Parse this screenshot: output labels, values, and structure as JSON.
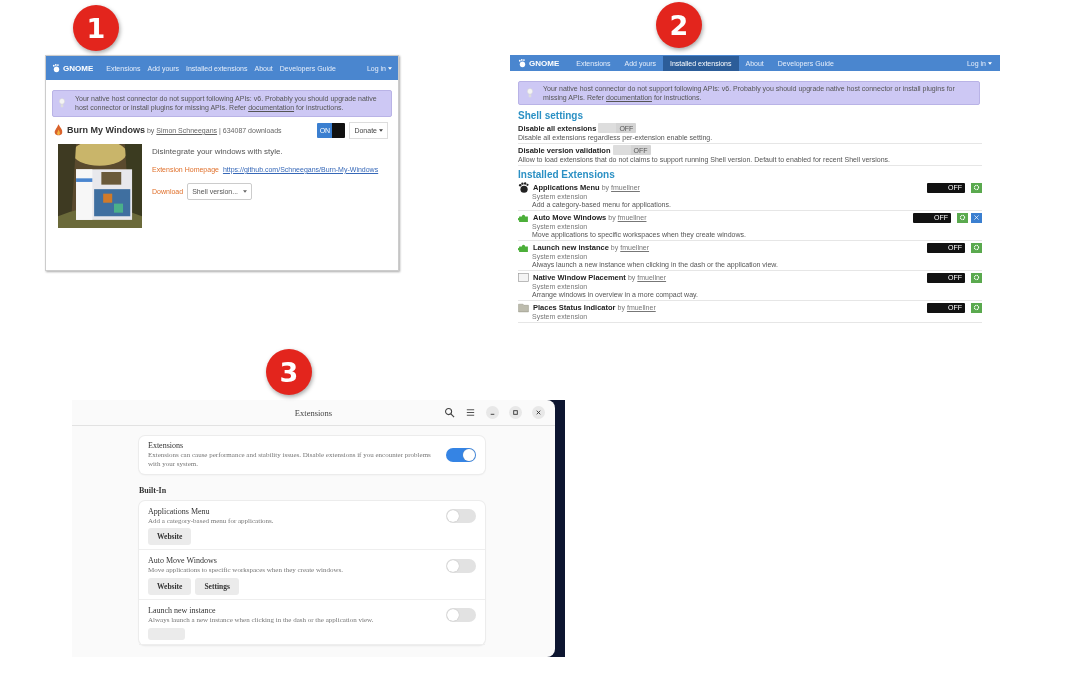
{
  "panels": [
    {
      "kind": "website",
      "badge": "1",
      "nav": {
        "logo": "GNOME",
        "items": [
          {
            "label": "Extensions",
            "selected": false
          },
          {
            "label": "Add yours",
            "selected": false
          },
          {
            "label": "Installed extensions",
            "selected": false
          },
          {
            "label": "About",
            "selected": false
          },
          {
            "label": "Developers Guide",
            "selected": false
          }
        ],
        "login": "Log in"
      },
      "notice": {
        "text": "Your native host connector do not support following APIs: v6. Probably you should upgrade native host connector or install plugins for missing APIs. Refer",
        "link": "documentation",
        "after": "for instructions."
      },
      "extension": {
        "name": "Burn My Windows",
        "by": "by",
        "author": "Simon Schneegans",
        "downloads": "| 634087 downloads",
        "on": true,
        "on_label": "ON",
        "donate": "Donate",
        "description": "Disintegrate your windows with style.",
        "homepage_label": "Extension Homepage",
        "homepage_url": "https://github.com/Schneegans/Burn-My-Windows",
        "download_label": "Download",
        "download_select": "Shell version..."
      }
    },
    {
      "kind": "installed",
      "badge": "2",
      "nav": {
        "logo": "GNOME",
        "items": [
          {
            "label": "Extensions",
            "selected": false
          },
          {
            "label": "Add yours",
            "selected": false
          },
          {
            "label": "Installed extensions",
            "selected": true
          },
          {
            "label": "About",
            "selected": false
          },
          {
            "label": "Developers Guide",
            "selected": false
          }
        ],
        "login": "Log in"
      },
      "notice": {
        "text": "Your native host connector do not support following APIs: v6. Probably you should upgrade native host connector or install plugins for missing APIs. Refer",
        "link": "documentation",
        "after": "for instructions."
      },
      "shell_heading": "Shell settings",
      "settings": [
        {
          "name": "Disable all extensions",
          "description": "Disable all extensions regardless per-extension enable setting.",
          "on": false,
          "disabled": true,
          "off_label": "OFF"
        },
        {
          "name": "Disable version validation",
          "description": "Allow to load extensions that do not claims to support running Shell version. Default to enabled for recent Shell versions.",
          "on": false,
          "disabled": true,
          "off_label": "OFF"
        }
      ],
      "installed_heading": "Installed Extensions",
      "extensions": [
        {
          "name": "Applications Menu",
          "by": "by",
          "author": "fmuellner",
          "type": "System extension",
          "description": "Add a category-based menu for applications.",
          "on": false,
          "off_label": "OFF",
          "extra_button": false
        },
        {
          "name": "Auto Move Windows",
          "by": "by",
          "author": "fmuellner",
          "type": "System extension",
          "description": "Move applications to specific workspaces when they create windows.",
          "on": false,
          "off_label": "OFF",
          "extra_button": true
        },
        {
          "name": "Launch new instance",
          "by": "by",
          "author": "fmuellner",
          "type": "System extension",
          "description": "Always launch a new instance when clicking in the dash or the application view.",
          "on": false,
          "off_label": "OFF",
          "extra_button": false
        },
        {
          "name": "Native Window Placement",
          "by": "by",
          "author": "fmuellner",
          "type": "System extension",
          "description": "Arrange windows in overview in a more compact way.",
          "on": false,
          "off_label": "OFF",
          "extra_button": false
        },
        {
          "name": "Places Status Indicator",
          "by": "by",
          "author": "fmuellner",
          "type": "System extension",
          "on": false,
          "off_label": "OFF",
          "extra_button": false
        }
      ]
    },
    {
      "kind": "app",
      "badge": "3",
      "title": "Extensions",
      "master": {
        "name": "Extensions",
        "description": "Extensions can cause performance and stability issues. Disable extensions if you encounter problems with your system.",
        "on": true
      },
      "section": "Built-In",
      "rows": [
        {
          "name": "Applications Menu",
          "description": "Add a category-based menu for applications.",
          "on": false,
          "buttons": [
            "Website"
          ]
        },
        {
          "name": "Auto Move Windows",
          "description": "Move applications to specific workspaces when they create windows.",
          "on": false,
          "buttons": [
            "Website",
            "Settings"
          ]
        },
        {
          "name": "Launch new instance",
          "description": "Always launch a new instance when clicking in the dash or the application view.",
          "on": false,
          "buttons": [],
          "cut_button": true
        }
      ]
    }
  ]
}
